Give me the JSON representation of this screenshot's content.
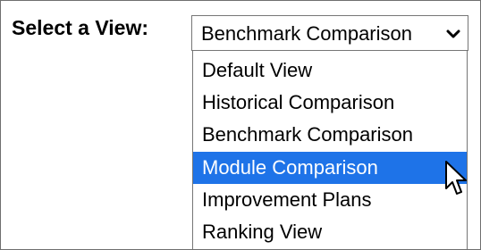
{
  "view_selector": {
    "label": "Select a View:",
    "selected_value": "Benchmark Comparison",
    "chevron_icon": "chevron-down-icon",
    "options": [
      {
        "label": "Default View"
      },
      {
        "label": "Historical Comparison"
      },
      {
        "label": "Benchmark Comparison"
      },
      {
        "label": "Module Comparison"
      },
      {
        "label": "Improvement Plans"
      },
      {
        "label": "Ranking View"
      }
    ],
    "highlighted_option": "Module Comparison"
  },
  "pointer": {
    "icon": "mouse-pointer-icon"
  },
  "colors": {
    "highlight": "#1e73e8",
    "border": "#767676"
  }
}
